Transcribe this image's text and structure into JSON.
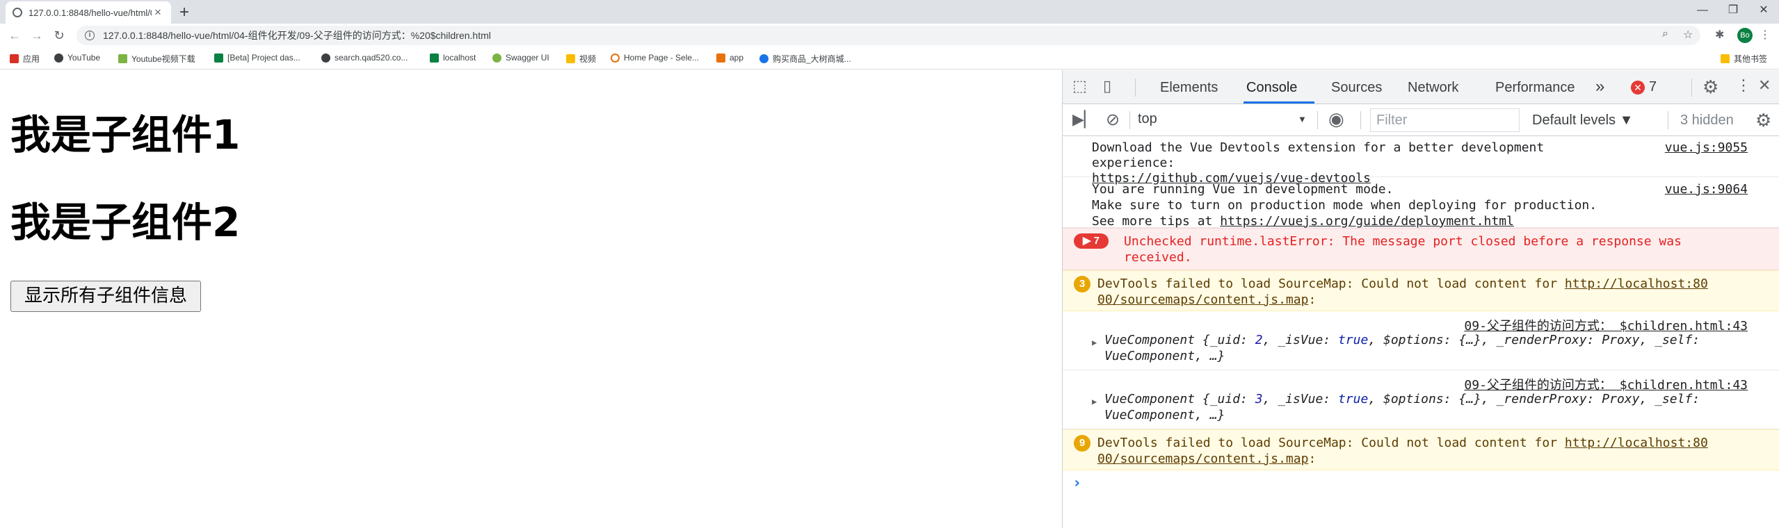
{
  "tab": {
    "title": "127.0.0.1:8848/hello-vue/html/0...",
    "close": "×",
    "new_tab": "+"
  },
  "window": {
    "minimize": "—",
    "restore": "❐",
    "close": "✕"
  },
  "address_bar": {
    "url": "127.0.0.1:8848/hello-vue/html/04-组件化开发/09-父子组件的访问方式：%20$children.html"
  },
  "profile_initials": "Bo",
  "bookmarks": [
    {
      "label": "应用",
      "color": "#d93025"
    },
    {
      "label": "YouTube",
      "color": "#3c4043"
    },
    {
      "label": "Youtube视频下载",
      "color": "#7cb342"
    },
    {
      "label": "[Beta] Project das...",
      "color": "#0b8043"
    },
    {
      "label": "search.qad520.co...",
      "color": "#3c4043"
    },
    {
      "label": "localhost",
      "color": "#0b8043"
    },
    {
      "label": "Swagger UI",
      "color": "#7cb342"
    },
    {
      "label": "视频",
      "color": "#fbbc04"
    },
    {
      "label": "Home Page - Sele...",
      "color": "#e8710a"
    },
    {
      "label": "app",
      "color": "#e8710a"
    },
    {
      "label": "购买商品_大树商城...",
      "color": "#1a73e8"
    }
  ],
  "other_bookmarks": "其他书签",
  "page": {
    "heading1": "我是子组件1",
    "heading2": "我是子组件2",
    "button": "显示所有子组件信息"
  },
  "devtools": {
    "tabs": [
      "Elements",
      "Console",
      "Sources",
      "Network",
      "Performance"
    ],
    "active_tab": "Console",
    "more": "»",
    "error_count": "7",
    "context": "top",
    "filter_placeholder": "Filter",
    "levels": "Default levels ▼",
    "hidden": "3 hidden",
    "messages": {
      "m1": {
        "lines": [
          "Download the Vue Devtools extension for a better development",
          "experience:"
        ],
        "link": "https://github.com/vuejs/vue-devtools",
        "source": "vue.js:9055"
      },
      "m2": {
        "lines": [
          "You are running Vue in development mode.",
          "Make sure to turn on production mode when deploying for production."
        ],
        "prefix": "See more tips at ",
        "link": "https://vuejs.org/guide/deployment.html",
        "source": "vue.js:9064"
      },
      "m3": {
        "count": "7",
        "lines": [
          "Unchecked runtime.lastError: The message port closed before a response was",
          "received."
        ]
      },
      "m4": {
        "count": "3",
        "prefix": "DevTools failed to load SourceMap: Could not load content for ",
        "link1": "http://localhost:80",
        "link2": "00/sourcemaps/content.js.map",
        "suffix": ":"
      },
      "m5": {
        "source": "09-父子组件的访问方式： $children.html:43",
        "obj_name": "VueComponent",
        "uid": "2",
        "line2": "VueComponent, …}"
      },
      "m6": {
        "source": "09-父子组件的访问方式： $children.html:43",
        "obj_name": "VueComponent",
        "uid": "3",
        "line2": "VueComponent, …}"
      },
      "m7": {
        "count": "9",
        "prefix": "DevTools failed to load SourceMap: Could not load content for ",
        "link1": "http://localhost:80",
        "link2": "00/sourcemaps/content.js.map",
        "suffix": ":"
      }
    },
    "prompt": "›"
  }
}
